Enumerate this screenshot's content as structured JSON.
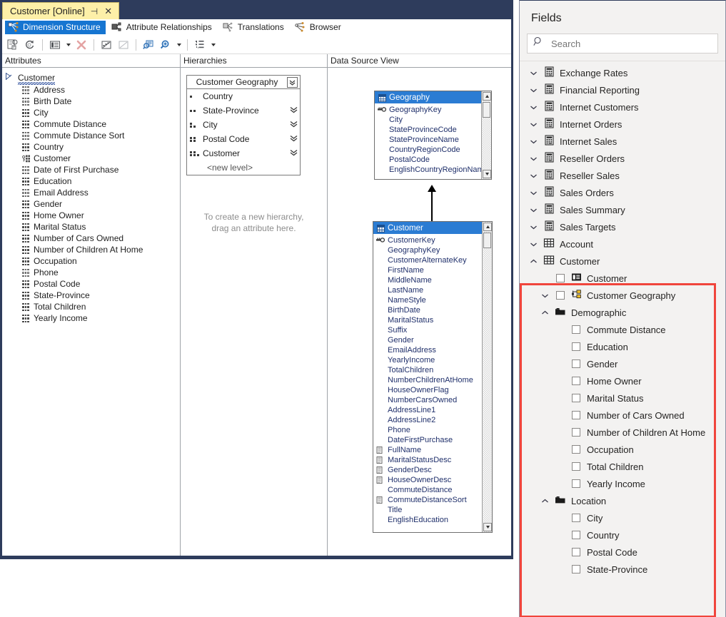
{
  "window": {
    "tab_title": "Customer [Online]",
    "pin_icon": "pin-icon",
    "close_icon": "close-icon"
  },
  "designer_tabs": [
    {
      "label": "Dimension Structure",
      "icon": "dimension-structure-icon",
      "selected": true
    },
    {
      "label": "Attribute Relationships",
      "icon": "attribute-relationships-icon",
      "selected": false
    },
    {
      "label": "Translations",
      "icon": "translations-icon",
      "selected": false
    },
    {
      "label": "Browser",
      "icon": "browser-icon",
      "selected": false
    }
  ],
  "toolbar": {
    "buttons": [
      {
        "name": "process-icon"
      },
      {
        "name": "refresh-icon"
      },
      {
        "name": "properties-list-icon",
        "has_caret": true
      },
      {
        "name": "delete-red-x-icon"
      },
      {
        "name": "show-attributes-grid-icon"
      },
      {
        "name": "hide-attributes-icon"
      },
      {
        "name": "query-zoom-icon"
      },
      {
        "name": "zoom-magnifier-icon",
        "has_caret": true
      },
      {
        "name": "tree-view-icon",
        "has_caret": true
      }
    ]
  },
  "panes": {
    "attributes": {
      "header": "Attributes",
      "root": "Customer",
      "items": [
        {
          "label": "Address",
          "icon": "attribute-hollow-icon"
        },
        {
          "label": "Birth Date",
          "icon": "attribute-hollow-icon"
        },
        {
          "label": "City",
          "icon": "attribute-solid-icon"
        },
        {
          "label": "Commute Distance",
          "icon": "attribute-solid-icon"
        },
        {
          "label": "Commute Distance Sort",
          "icon": "attribute-hollow-icon"
        },
        {
          "label": "Country",
          "icon": "attribute-solid-icon"
        },
        {
          "label": "Customer",
          "icon": "attribute-key-icon"
        },
        {
          "label": "Date of First Purchase",
          "icon": "attribute-hollow-icon"
        },
        {
          "label": "Education",
          "icon": "attribute-solid-icon"
        },
        {
          "label": "Email Address",
          "icon": "attribute-hollow-icon"
        },
        {
          "label": "Gender",
          "icon": "attribute-solid-icon"
        },
        {
          "label": "Home Owner",
          "icon": "attribute-solid-icon"
        },
        {
          "label": "Marital Status",
          "icon": "attribute-solid-icon"
        },
        {
          "label": "Number of Cars Owned",
          "icon": "attribute-solid-icon"
        },
        {
          "label": "Number of Children At Home",
          "icon": "attribute-solid-icon"
        },
        {
          "label": "Occupation",
          "icon": "attribute-solid-icon"
        },
        {
          "label": "Phone",
          "icon": "attribute-hollow-icon"
        },
        {
          "label": "Postal Code",
          "icon": "attribute-solid-icon"
        },
        {
          "label": "State-Province",
          "icon": "attribute-solid-icon"
        },
        {
          "label": "Total Children",
          "icon": "attribute-solid-icon"
        },
        {
          "label": "Yearly Income",
          "icon": "attribute-solid-icon"
        }
      ]
    },
    "hierarchies": {
      "header": "Hierarchies",
      "hierarchy_name": "Customer Geography",
      "levels": [
        {
          "label": "Country",
          "dots": 1,
          "has_chevron": false
        },
        {
          "label": "State-Province",
          "dots": 2,
          "has_chevron": true
        },
        {
          "label": "City",
          "dots": 3,
          "has_chevron": true
        },
        {
          "label": "Postal Code",
          "dots": 4,
          "has_chevron": true
        },
        {
          "label": "Customer",
          "dots": 5,
          "has_chevron": true
        }
      ],
      "new_level": "<new level>",
      "hint_line1": "To create a new hierarchy,",
      "hint_line2": "drag an attribute here."
    },
    "data_source_view": {
      "header": "Data Source View",
      "tables": [
        {
          "name": "Geography",
          "columns": [
            {
              "label": "GeographyKey",
              "icon": "primary-key-icon"
            },
            {
              "label": "City",
              "icon": ""
            },
            {
              "label": "StateProvinceCode",
              "icon": ""
            },
            {
              "label": "StateProvinceName",
              "icon": ""
            },
            {
              "label": "CountryRegionCode",
              "icon": ""
            },
            {
              "label": "PostalCode",
              "icon": ""
            },
            {
              "label": "EnglishCountryRegionName",
              "icon": ""
            }
          ]
        },
        {
          "name": "Customer",
          "columns": [
            {
              "label": "CustomerKey",
              "icon": "primary-key-icon"
            },
            {
              "label": "GeographyKey",
              "icon": ""
            },
            {
              "label": "CustomerAlternateKey",
              "icon": ""
            },
            {
              "label": "FirstName",
              "icon": ""
            },
            {
              "label": "MiddleName",
              "icon": ""
            },
            {
              "label": "LastName",
              "icon": ""
            },
            {
              "label": "NameStyle",
              "icon": ""
            },
            {
              "label": "BirthDate",
              "icon": ""
            },
            {
              "label": "MaritalStatus",
              "icon": ""
            },
            {
              "label": "Suffix",
              "icon": ""
            },
            {
              "label": "Gender",
              "icon": ""
            },
            {
              "label": "EmailAddress",
              "icon": ""
            },
            {
              "label": "YearlyIncome",
              "icon": ""
            },
            {
              "label": "TotalChildren",
              "icon": ""
            },
            {
              "label": "NumberChildrenAtHome",
              "icon": ""
            },
            {
              "label": "HouseOwnerFlag",
              "icon": ""
            },
            {
              "label": "NumberCarsOwned",
              "icon": ""
            },
            {
              "label": "AddressLine1",
              "icon": ""
            },
            {
              "label": "AddressLine2",
              "icon": ""
            },
            {
              "label": "Phone",
              "icon": ""
            },
            {
              "label": "DateFirstPurchase",
              "icon": ""
            },
            {
              "label": "FullName",
              "icon": "calculated-column-icon"
            },
            {
              "label": "MaritalStatusDesc",
              "icon": "calculated-column-icon"
            },
            {
              "label": "GenderDesc",
              "icon": "calculated-column-icon"
            },
            {
              "label": "HouseOwnerDesc",
              "icon": "calculated-column-icon"
            },
            {
              "label": "CommuteDistance",
              "icon": ""
            },
            {
              "label": "CommuteDistanceSort",
              "icon": "calculated-column-icon"
            },
            {
              "label": "Title",
              "icon": ""
            },
            {
              "label": "EnglishEducation",
              "icon": ""
            }
          ]
        }
      ]
    }
  },
  "fields_panel": {
    "title": "Fields",
    "search_placeholder": "Search",
    "search_value": "",
    "search_icon": "search-icon",
    "groups": [
      {
        "label": "Exchange Rates",
        "icon": "measure-group-icon",
        "expanded": false,
        "indent": 0
      },
      {
        "label": "Financial Reporting",
        "icon": "measure-group-icon",
        "expanded": false,
        "indent": 0
      },
      {
        "label": "Internet Customers",
        "icon": "measure-group-icon",
        "expanded": false,
        "indent": 0
      },
      {
        "label": "Internet Orders",
        "icon": "measure-group-icon",
        "expanded": false,
        "indent": 0
      },
      {
        "label": "Internet Sales",
        "icon": "measure-group-icon",
        "expanded": false,
        "indent": 0
      },
      {
        "label": "Reseller Orders",
        "icon": "measure-group-icon",
        "expanded": false,
        "indent": 0
      },
      {
        "label": "Reseller Sales",
        "icon": "measure-group-icon",
        "expanded": false,
        "indent": 0
      },
      {
        "label": "Sales Orders",
        "icon": "measure-group-icon",
        "expanded": false,
        "indent": 0
      },
      {
        "label": "Sales Summary",
        "icon": "measure-group-icon",
        "expanded": false,
        "indent": 0
      },
      {
        "label": "Sales Targets",
        "icon": "measure-group-icon",
        "expanded": false,
        "indent": 0
      },
      {
        "label": "Account",
        "icon": "table-icon",
        "expanded": false,
        "indent": 0
      },
      {
        "label": "Customer",
        "icon": "table-icon",
        "expanded": true,
        "indent": 0,
        "highlighted": true
      }
    ],
    "customer_children": [
      {
        "label": "Customer",
        "type": "attribute-hierarchy",
        "checkbox": true,
        "chevron": "",
        "indent": 1
      },
      {
        "label": "Customer Geography",
        "type": "user-hierarchy",
        "checkbox": true,
        "chevron": "down",
        "indent": 1
      },
      {
        "label": "Demographic",
        "type": "folder",
        "checkbox": false,
        "chevron": "up",
        "indent": 1
      },
      {
        "label": "Commute Distance",
        "type": "field",
        "checkbox": true,
        "chevron": "",
        "indent": 2
      },
      {
        "label": "Education",
        "type": "field",
        "checkbox": true,
        "chevron": "",
        "indent": 2
      },
      {
        "label": "Gender",
        "type": "field",
        "checkbox": true,
        "chevron": "",
        "indent": 2
      },
      {
        "label": "Home Owner",
        "type": "field",
        "checkbox": true,
        "chevron": "",
        "indent": 2
      },
      {
        "label": "Marital Status",
        "type": "field",
        "checkbox": true,
        "chevron": "",
        "indent": 2
      },
      {
        "label": "Number of Cars Owned",
        "type": "field",
        "checkbox": true,
        "chevron": "",
        "indent": 2
      },
      {
        "label": "Number of Children At Home",
        "type": "field",
        "checkbox": true,
        "chevron": "",
        "indent": 2
      },
      {
        "label": "Occupation",
        "type": "field",
        "checkbox": true,
        "chevron": "",
        "indent": 2
      },
      {
        "label": "Total Children",
        "type": "field",
        "checkbox": true,
        "chevron": "",
        "indent": 2
      },
      {
        "label": "Yearly Income",
        "type": "field",
        "checkbox": true,
        "chevron": "",
        "indent": 2
      },
      {
        "label": "Location",
        "type": "folder",
        "checkbox": false,
        "chevron": "up",
        "indent": 1
      },
      {
        "label": "City",
        "type": "field",
        "checkbox": true,
        "chevron": "",
        "indent": 2
      },
      {
        "label": "Country",
        "type": "field",
        "checkbox": true,
        "chevron": "",
        "indent": 2
      },
      {
        "label": "Postal Code",
        "type": "field",
        "checkbox": true,
        "chevron": "",
        "indent": 2
      },
      {
        "label": "State-Province",
        "type": "field",
        "checkbox": true,
        "chevron": "",
        "indent": 2
      }
    ]
  },
  "colors": {
    "titlebar": "#2e3c5c",
    "active_tab": "#fdf0a8",
    "selected_tab": "#1675d1",
    "dsv_header": "#2b7cd3",
    "highlight": "#f0453c",
    "panel_bg": "#f3f2f1"
  }
}
